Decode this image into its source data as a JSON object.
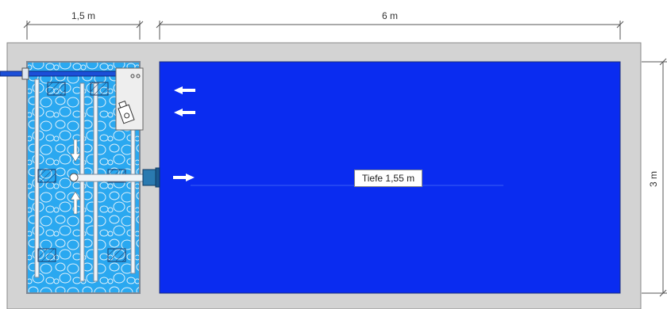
{
  "dimensions": {
    "filter_width": "1,5 m",
    "pool_length": "6 m",
    "pool_width": "3 m"
  },
  "pool": {
    "depth_label": "Tiefe 1,55 m"
  },
  "colors": {
    "surround": "#d3d3d3",
    "pool_water": "#0a2cf0",
    "filter_water": "#2aa8f0",
    "pebble_outline": "#dff1fb",
    "pipe": "#eef3f8",
    "flow_arrow": "#ffffff"
  },
  "icons": [
    "inlet-pipe-icon",
    "skimmer-box-icon",
    "pump-icon",
    "flow-arrow-icon",
    "outlet-pipe-icon"
  ]
}
